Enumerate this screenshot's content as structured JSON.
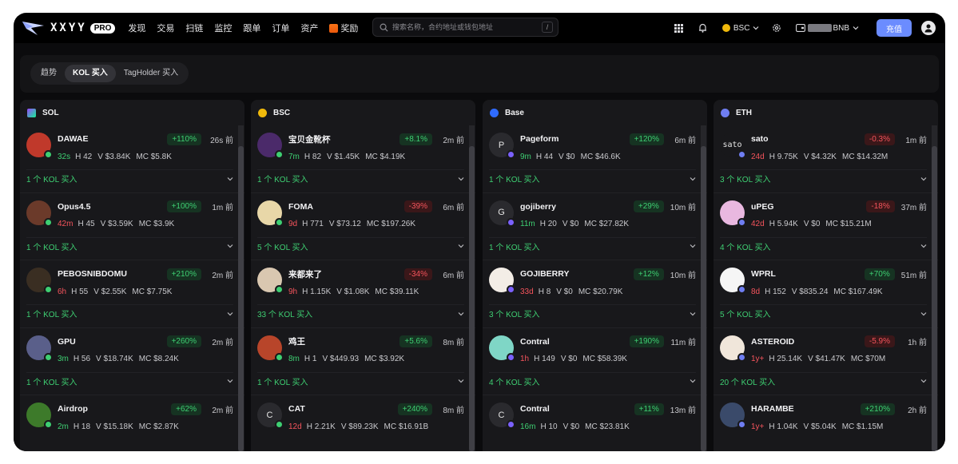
{
  "nav": {
    "logo_text": "XXYY",
    "pro_badge": "PRO",
    "menu": [
      "发现",
      "交易",
      "扫链",
      "监控",
      "跟单",
      "订单",
      "资产"
    ],
    "reward": "奖励",
    "search_placeholder": "搜索名称，合约地址或钱包地址",
    "search_shortcut": "/",
    "chain": "BSC",
    "wallet_unit": "BNB",
    "deposit": "充值",
    "colors": {
      "accent": "#6b8cff",
      "bsc": "#f0b90b"
    }
  },
  "tabs": [
    "趋势",
    "KOL 买入",
    "TagHolder 买入"
  ],
  "active_tab": 1,
  "columns": [
    {
      "chain": "SOL",
      "icon": "solana-icon",
      "tokens": [
        {
          "name": "DAWAE",
          "change": "+110%",
          "dir": "up",
          "time": "26s 前",
          "age": "32s",
          "age_color": "green",
          "h": "H 42",
          "v": "V $3.84K",
          "mc": "MC $5.8K",
          "kol": "1 个 KOL 买入",
          "avatar_color": "#c0392b"
        },
        {
          "name": "Opus4.5",
          "change": "+100%",
          "dir": "up",
          "time": "1m 前",
          "age": "42m",
          "age_color": "red",
          "h": "H 45",
          "v": "V $3.59K",
          "mc": "MC $3.9K",
          "kol": "1 个 KOL 买入",
          "avatar_color": "#6b3a2a"
        },
        {
          "name": "PEBOSNIBDOMU",
          "change": "+210%",
          "dir": "up",
          "time": "2m 前",
          "age": "6h",
          "age_color": "red",
          "h": "H 55",
          "v": "V $2.55K",
          "mc": "MC $7.75K",
          "kol": "1 个 KOL 买入",
          "avatar_color": "#3a2e22"
        },
        {
          "name": "GPU",
          "change": "+260%",
          "dir": "up",
          "time": "2m 前",
          "age": "3m",
          "age_color": "green",
          "h": "H 56",
          "v": "V $18.74K",
          "mc": "MC $8.24K",
          "kol": "1 个 KOL 买入",
          "avatar_color": "#5a5f8a"
        },
        {
          "name": "Airdrop",
          "change": "+62%",
          "dir": "up",
          "time": "2m 前",
          "age": "2m",
          "age_color": "green",
          "h": "H 18",
          "v": "V $15.18K",
          "mc": "MC $2.87K",
          "kol": "",
          "avatar_color": "#3d7a2a"
        }
      ]
    },
    {
      "chain": "BSC",
      "icon": "bnb-icon",
      "tokens": [
        {
          "name": "宝贝金靴杯",
          "change": "+8.1%",
          "dir": "up",
          "time": "2m 前",
          "age": "7m",
          "age_color": "green",
          "h": "H 82",
          "v": "V $1.45K",
          "mc": "MC $4.19K",
          "kol": "1 个 KOL 买入",
          "avatar_color": "#4b2a6a"
        },
        {
          "name": "FOMA",
          "change": "-39%",
          "dir": "down",
          "time": "6m 前",
          "age": "9d",
          "age_color": "red",
          "h": "H 771",
          "v": "V $73.12",
          "mc": "MC $197.26K",
          "kol": "5 个 KOL 买入",
          "avatar_color": "#e8d7a8"
        },
        {
          "name": "来都来了",
          "change": "-34%",
          "dir": "down",
          "time": "6m 前",
          "age": "9h",
          "age_color": "red",
          "h": "H 1.15K",
          "v": "V $1.08K",
          "mc": "MC $39.11K",
          "kol": "33 个 KOL 买入",
          "avatar_color": "#d9c7b0"
        },
        {
          "name": "鸡王",
          "change": "+5.6%",
          "dir": "up",
          "time": "8m 前",
          "age": "8m",
          "age_color": "green",
          "h": "H 1",
          "v": "V $449.93",
          "mc": "MC $3.92K",
          "kol": "1 个 KOL 买入",
          "avatar_color": "#b8452a"
        },
        {
          "name": "CAT",
          "change": "+240%",
          "dir": "up",
          "time": "8m 前",
          "age": "12d",
          "age_color": "red",
          "h": "H 2.21K",
          "v": "V $89.23K",
          "mc": "MC $16.91B",
          "kol": "",
          "avatar_color": "#2a2a2e",
          "letter": "C"
        }
      ]
    },
    {
      "chain": "Base",
      "icon": "base-icon",
      "tokens": [
        {
          "name": "Pageform",
          "change": "+120%",
          "dir": "up",
          "time": "6m 前",
          "age": "9m",
          "age_color": "green",
          "h": "H 44",
          "v": "V $0",
          "mc": "MC $46.6K",
          "kol": "1 个 KOL 买入",
          "avatar_color": "#2a2a2e",
          "letter": "P"
        },
        {
          "name": "gojiberry",
          "change": "+29%",
          "dir": "up",
          "time": "10m 前",
          "age": "11m",
          "age_color": "green",
          "h": "H 20",
          "v": "V $0",
          "mc": "MC $27.82K",
          "kol": "1 个 KOL 买入",
          "avatar_color": "#2a2a2e",
          "letter": "G"
        },
        {
          "name": "GOJIBERRY",
          "change": "+12%",
          "dir": "up",
          "time": "10m 前",
          "age": "33d",
          "age_color": "red",
          "h": "H 8",
          "v": "V $0",
          "mc": "MC $20.79K",
          "kol": "3 个 KOL 买入",
          "avatar_color": "#f3ede6"
        },
        {
          "name": "Contral",
          "change": "+190%",
          "dir": "up",
          "time": "11m 前",
          "age": "1h",
          "age_color": "red",
          "h": "H 149",
          "v": "V $0",
          "mc": "MC $58.39K",
          "kol": "4 个 KOL 买入",
          "avatar_color": "#7fd6c6"
        },
        {
          "name": "Contral",
          "change": "+11%",
          "dir": "up",
          "time": "13m 前",
          "age": "16m",
          "age_color": "green",
          "h": "H 10",
          "v": "V $0",
          "mc": "MC $23.81K",
          "kol": "",
          "avatar_color": "#2a2a2e",
          "letter": "C"
        }
      ]
    },
    {
      "chain": "ETH",
      "icon": "ethereum-icon",
      "tokens": [
        {
          "name": "sato",
          "change": "-0.3%",
          "dir": "down",
          "time": "1m 前",
          "age": "24d",
          "age_color": "red",
          "h": "H 9.75K",
          "v": "V $4.32K",
          "mc": "MC $14.32M",
          "kol": "3 个 KOL 买入",
          "avatar_color": "#18181b",
          "letter": "sato"
        },
        {
          "name": "uPEG",
          "change": "-18%",
          "dir": "down",
          "time": "37m 前",
          "age": "42d",
          "age_color": "red",
          "h": "H 5.94K",
          "v": "V $0",
          "mc": "MC $15.21M",
          "kol": "4 个 KOL 买入",
          "avatar_color": "#e9b8e0"
        },
        {
          "name": "WPRL",
          "change": "+70%",
          "dir": "up",
          "time": "51m 前",
          "age": "8d",
          "age_color": "red",
          "h": "H 152",
          "v": "V $835.24",
          "mc": "MC $167.49K",
          "kol": "5 个 KOL 买入",
          "avatar_color": "#f5f5f5"
        },
        {
          "name": "ASTEROID",
          "change": "-5.9%",
          "dir": "down",
          "time": "1h 前",
          "age": "1y+",
          "age_color": "red",
          "h": "H 25.14K",
          "v": "V $41.47K",
          "mc": "MC $70M",
          "kol": "20 个 KOL 买入",
          "avatar_color": "#f0e6da"
        },
        {
          "name": "HARAMBE",
          "change": "+210%",
          "dir": "up",
          "time": "2h 前",
          "age": "1y+",
          "age_color": "red",
          "h": "H 1.04K",
          "v": "V $5.04K",
          "mc": "MC $1.15M",
          "kol": "",
          "avatar_color": "#3a4a6a"
        }
      ]
    }
  ]
}
